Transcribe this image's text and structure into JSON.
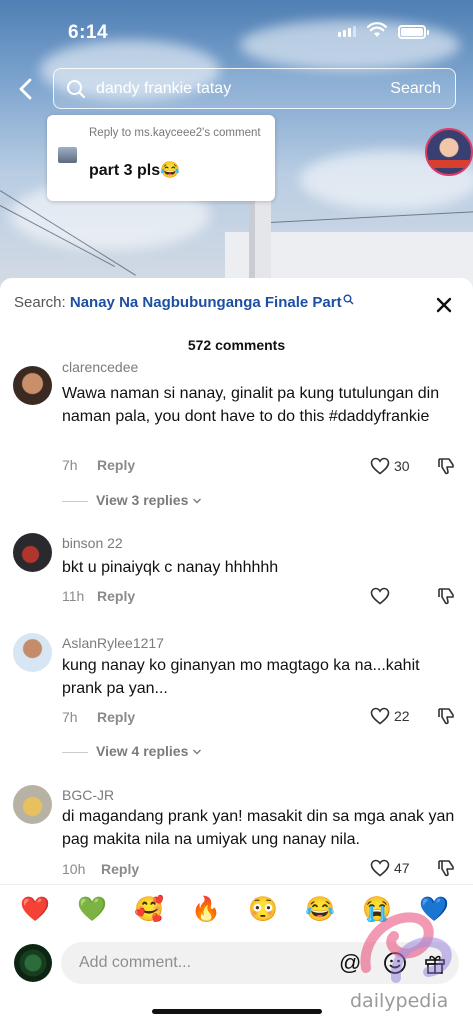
{
  "status_bar": {
    "time": "6:14"
  },
  "search": {
    "query": "dandy frankie tatay",
    "button_label": "Search"
  },
  "reply_bubble": {
    "reply_to": "Reply to ms.kayceee2's comment",
    "text": "part 3 pls😂"
  },
  "sheet": {
    "search_prefix": "Search:",
    "search_link": "Nanay Na Nagbubunganga Finale Part",
    "comment_count": "572 comments"
  },
  "comments": [
    {
      "username": "clarencedee",
      "text": "Wawa naman si nanay, ginalit pa kung tutulungan din naman pala, you dont have to do this #daddyfrankie",
      "time": "7h",
      "reply_label": "Reply",
      "likes": "30",
      "view_replies": "View 3 replies"
    },
    {
      "username": "binson 22",
      "text": "bkt u pinaiyqk c nanay hhhhhh",
      "time": "11h",
      "reply_label": "Reply",
      "likes": ""
    },
    {
      "username": "AslanRylee1217",
      "text": "kung nanay ko ginanyan mo magtago ka na...kahit prank pa yan...",
      "time": "7h",
      "reply_label": "Reply",
      "likes": "22",
      "view_replies": "View 4 replies"
    },
    {
      "username": "BGC-JR",
      "text": "di magandang prank yan! masakit din sa mga anak yan pag makita nila na umiyak ung nanay nila.",
      "time": "10h",
      "reply_label": "Reply",
      "likes": "47"
    }
  ],
  "emojis": [
    "❤️",
    "💚",
    "🥰",
    "🔥",
    "😳",
    "😂",
    "😭",
    "💙"
  ],
  "input": {
    "placeholder": "Add comment..."
  },
  "watermark": {
    "text": "dailypedia"
  },
  "colors": {
    "link": "#1e4fa3",
    "muted": "#8a8a8a"
  },
  "icons": [
    "back-arrow-icon",
    "search-icon",
    "close-icon",
    "heart-icon",
    "dislike-icon",
    "chevron-down-icon",
    "at-icon",
    "smile-icon",
    "gift-icon"
  ]
}
